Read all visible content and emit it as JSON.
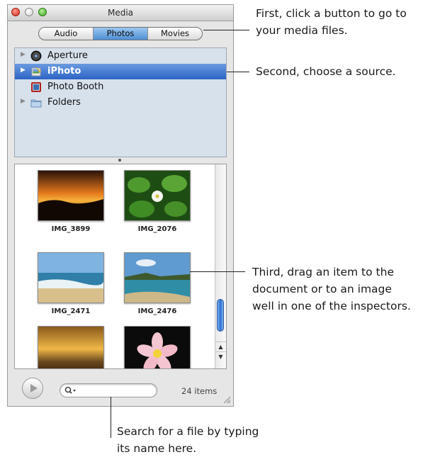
{
  "window": {
    "title": "Media",
    "tabs": [
      {
        "label": "Audio",
        "active": false
      },
      {
        "label": "Photos",
        "active": true
      },
      {
        "label": "Movies",
        "active": false
      }
    ],
    "sources": [
      {
        "label": "Aperture",
        "icon": "aperture-icon",
        "expandable": true,
        "selected": false
      },
      {
        "label": "iPhoto",
        "icon": "iphoto-icon",
        "expandable": true,
        "selected": true
      },
      {
        "label": "Photo Booth",
        "icon": "photo-booth-icon",
        "expandable": false,
        "selected": false
      },
      {
        "label": "Folders",
        "icon": "folder-icon",
        "expandable": true,
        "selected": false
      }
    ],
    "photos": [
      {
        "caption": "IMG_3899"
      },
      {
        "caption": "IMG_2076"
      },
      {
        "caption": "IMG_2471"
      },
      {
        "caption": "IMG_2476"
      },
      {
        "caption": ""
      },
      {
        "caption": ""
      }
    ],
    "search": {
      "value": "",
      "placeholder": ""
    },
    "item_count": "24 items"
  },
  "callouts": {
    "first": {
      "line1": "First, click a button to go to",
      "line2": "your media files."
    },
    "second": {
      "line1": "Second, choose a source."
    },
    "third": {
      "line1": "Third, drag an item to the",
      "line2": "document or to an image",
      "line3": "well in one of the inspectors."
    },
    "search": {
      "line1": "Search for a file by typing",
      "line2": "its name here."
    }
  },
  "colors": {
    "selection": "#2c64c4",
    "active_tab": "#4f8fd4",
    "source_list_bg": "#d7e1ec"
  }
}
